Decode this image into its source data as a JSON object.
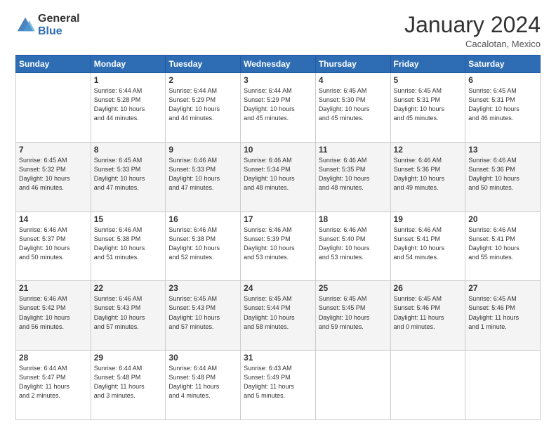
{
  "logo": {
    "general": "General",
    "blue": "Blue"
  },
  "title": "January 2024",
  "location": "Cacalotan, Mexico",
  "weekdays": [
    "Sunday",
    "Monday",
    "Tuesday",
    "Wednesday",
    "Thursday",
    "Friday",
    "Saturday"
  ],
  "weeks": [
    [
      {
        "day": "",
        "info": ""
      },
      {
        "day": "1",
        "info": "Sunrise: 6:44 AM\nSunset: 5:28 PM\nDaylight: 10 hours\nand 44 minutes."
      },
      {
        "day": "2",
        "info": "Sunrise: 6:44 AM\nSunset: 5:29 PM\nDaylight: 10 hours\nand 44 minutes."
      },
      {
        "day": "3",
        "info": "Sunrise: 6:44 AM\nSunset: 5:29 PM\nDaylight: 10 hours\nand 45 minutes."
      },
      {
        "day": "4",
        "info": "Sunrise: 6:45 AM\nSunset: 5:30 PM\nDaylight: 10 hours\nand 45 minutes."
      },
      {
        "day": "5",
        "info": "Sunrise: 6:45 AM\nSunset: 5:31 PM\nDaylight: 10 hours\nand 45 minutes."
      },
      {
        "day": "6",
        "info": "Sunrise: 6:45 AM\nSunset: 5:31 PM\nDaylight: 10 hours\nand 46 minutes."
      }
    ],
    [
      {
        "day": "7",
        "info": "Sunrise: 6:45 AM\nSunset: 5:32 PM\nDaylight: 10 hours\nand 46 minutes."
      },
      {
        "day": "8",
        "info": "Sunrise: 6:45 AM\nSunset: 5:33 PM\nDaylight: 10 hours\nand 47 minutes."
      },
      {
        "day": "9",
        "info": "Sunrise: 6:46 AM\nSunset: 5:33 PM\nDaylight: 10 hours\nand 47 minutes."
      },
      {
        "day": "10",
        "info": "Sunrise: 6:46 AM\nSunset: 5:34 PM\nDaylight: 10 hours\nand 48 minutes."
      },
      {
        "day": "11",
        "info": "Sunrise: 6:46 AM\nSunset: 5:35 PM\nDaylight: 10 hours\nand 48 minutes."
      },
      {
        "day": "12",
        "info": "Sunrise: 6:46 AM\nSunset: 5:36 PM\nDaylight: 10 hours\nand 49 minutes."
      },
      {
        "day": "13",
        "info": "Sunrise: 6:46 AM\nSunset: 5:36 PM\nDaylight: 10 hours\nand 50 minutes."
      }
    ],
    [
      {
        "day": "14",
        "info": "Sunrise: 6:46 AM\nSunset: 5:37 PM\nDaylight: 10 hours\nand 50 minutes."
      },
      {
        "day": "15",
        "info": "Sunrise: 6:46 AM\nSunset: 5:38 PM\nDaylight: 10 hours\nand 51 minutes."
      },
      {
        "day": "16",
        "info": "Sunrise: 6:46 AM\nSunset: 5:38 PM\nDaylight: 10 hours\nand 52 minutes."
      },
      {
        "day": "17",
        "info": "Sunrise: 6:46 AM\nSunset: 5:39 PM\nDaylight: 10 hours\nand 53 minutes."
      },
      {
        "day": "18",
        "info": "Sunrise: 6:46 AM\nSunset: 5:40 PM\nDaylight: 10 hours\nand 53 minutes."
      },
      {
        "day": "19",
        "info": "Sunrise: 6:46 AM\nSunset: 5:41 PM\nDaylight: 10 hours\nand 54 minutes."
      },
      {
        "day": "20",
        "info": "Sunrise: 6:46 AM\nSunset: 5:41 PM\nDaylight: 10 hours\nand 55 minutes."
      }
    ],
    [
      {
        "day": "21",
        "info": "Sunrise: 6:46 AM\nSunset: 5:42 PM\nDaylight: 10 hours\nand 56 minutes."
      },
      {
        "day": "22",
        "info": "Sunrise: 6:46 AM\nSunset: 5:43 PM\nDaylight: 10 hours\nand 57 minutes."
      },
      {
        "day": "23",
        "info": "Sunrise: 6:45 AM\nSunset: 5:43 PM\nDaylight: 10 hours\nand 57 minutes."
      },
      {
        "day": "24",
        "info": "Sunrise: 6:45 AM\nSunset: 5:44 PM\nDaylight: 10 hours\nand 58 minutes."
      },
      {
        "day": "25",
        "info": "Sunrise: 6:45 AM\nSunset: 5:45 PM\nDaylight: 10 hours\nand 59 minutes."
      },
      {
        "day": "26",
        "info": "Sunrise: 6:45 AM\nSunset: 5:46 PM\nDaylight: 11 hours\nand 0 minutes."
      },
      {
        "day": "27",
        "info": "Sunrise: 6:45 AM\nSunset: 5:46 PM\nDaylight: 11 hours\nand 1 minute."
      }
    ],
    [
      {
        "day": "28",
        "info": "Sunrise: 6:44 AM\nSunset: 5:47 PM\nDaylight: 11 hours\nand 2 minutes."
      },
      {
        "day": "29",
        "info": "Sunrise: 6:44 AM\nSunset: 5:48 PM\nDaylight: 11 hours\nand 3 minutes."
      },
      {
        "day": "30",
        "info": "Sunrise: 6:44 AM\nSunset: 5:48 PM\nDaylight: 11 hours\nand 4 minutes."
      },
      {
        "day": "31",
        "info": "Sunrise: 6:43 AM\nSunset: 5:49 PM\nDaylight: 11 hours\nand 5 minutes."
      },
      {
        "day": "",
        "info": ""
      },
      {
        "day": "",
        "info": ""
      },
      {
        "day": "",
        "info": ""
      }
    ]
  ]
}
